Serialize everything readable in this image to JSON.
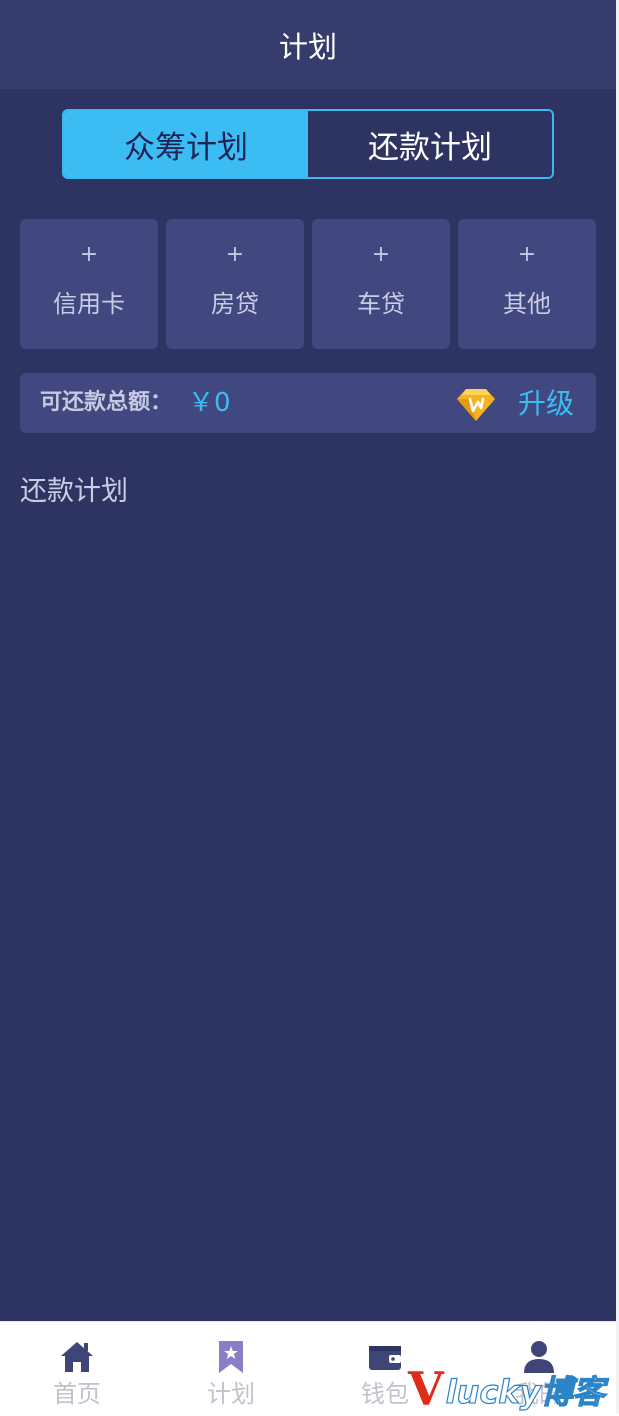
{
  "header": {
    "title": "计划"
  },
  "tabs": [
    {
      "label": "众筹计划",
      "active": true
    },
    {
      "label": "还款计划",
      "active": false
    }
  ],
  "cards": [
    {
      "plus": "+",
      "label": "信用卡"
    },
    {
      "plus": "+",
      "label": "房贷"
    },
    {
      "plus": "+",
      "label": "车贷"
    },
    {
      "plus": "+",
      "label": "其他"
    }
  ],
  "summary": {
    "label": "可还款总额：",
    "value": "￥0",
    "upgrade": "升级",
    "vip_icon": "vip-diamond-icon"
  },
  "section": {
    "title": "还款计划"
  },
  "tabbar": [
    {
      "label": "首页",
      "icon": "home-icon"
    },
    {
      "label": "计划",
      "icon": "bookmark-star-icon"
    },
    {
      "label": "钱包",
      "icon": "wallet-icon"
    },
    {
      "label": "我的",
      "icon": "user-icon"
    }
  ],
  "watermark": {
    "v": "V",
    "text": "lucky博客"
  },
  "colors": {
    "background": "#2e3462",
    "header": "#363c6c",
    "card": "#414880",
    "accent": "#3bbdf3",
    "vip_gold": "#f6b31e"
  }
}
